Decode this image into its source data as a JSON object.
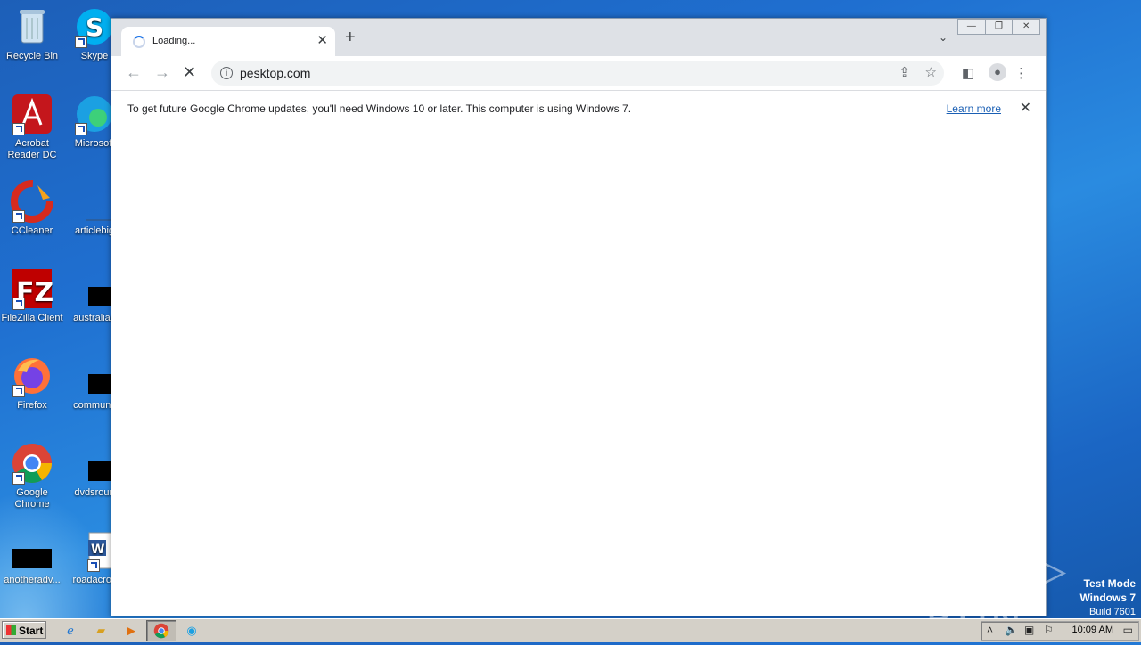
{
  "desktop": {
    "icons": [
      {
        "label": "Recycle Bin"
      },
      {
        "label": "Skype"
      },
      {
        "label": "Acrobat Reader DC"
      },
      {
        "label": "Microsoft"
      },
      {
        "label": "CCleaner"
      },
      {
        "label": "articlebig"
      },
      {
        "label": "FileZilla Client"
      },
      {
        "label": "australian"
      },
      {
        "label": "Firefox"
      },
      {
        "label": "communit"
      },
      {
        "label": "Google Chrome"
      },
      {
        "label": "dvdsroun"
      },
      {
        "label": "anotheradv..."
      },
      {
        "label": "roadacros"
      }
    ]
  },
  "browser": {
    "tab": {
      "title": "Loading...",
      "close": "✕"
    },
    "new_tab": "+",
    "tab_search": "⌄",
    "window_controls": {
      "minimize": "—",
      "restore": "❐",
      "close": "✕"
    },
    "url": "pesktop.com",
    "infobar": {
      "message": "To get future Google Chrome updates, you'll need Windows 10 or later. This computer is using Windows 7.",
      "link": "Learn more",
      "close": "✕"
    }
  },
  "watermark": {
    "text": "ANY ▷ RUN"
  },
  "test_mode": {
    "line1": "Test Mode",
    "line2": "Windows 7",
    "line3": "Build 7601"
  },
  "taskbar": {
    "start_label": "Start",
    "clock": "10:09 AM"
  },
  "colors": {
    "desktop": "#1f6fd0",
    "chrome_tabstrip": "#dee1e6",
    "link": "#1a5fb4",
    "taskbar": "#d4d0c8"
  }
}
